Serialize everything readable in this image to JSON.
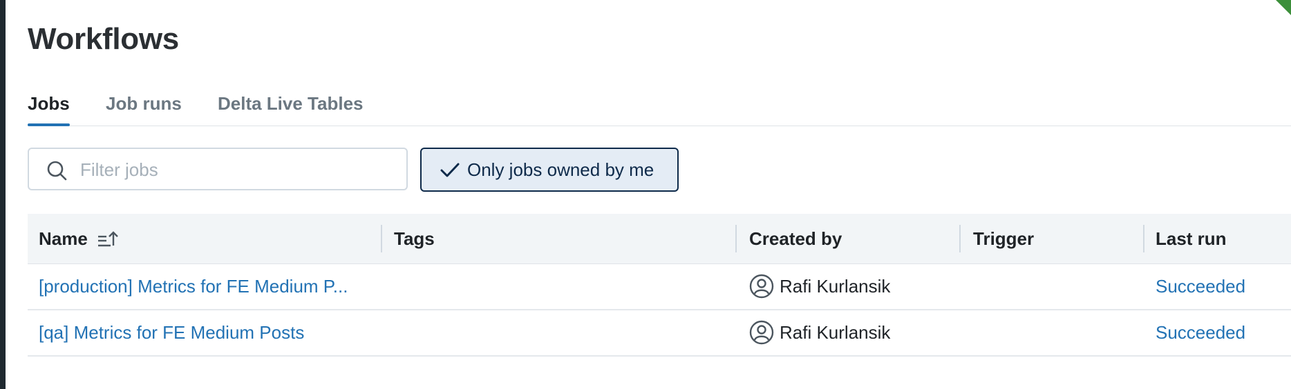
{
  "page": {
    "title": "Workflows"
  },
  "tabs": [
    {
      "label": "Jobs",
      "active": true
    },
    {
      "label": "Job runs",
      "active": false
    },
    {
      "label": "Delta Live Tables",
      "active": false
    }
  ],
  "search": {
    "placeholder": "Filter jobs",
    "value": "",
    "icon": "search-icon"
  },
  "filter_toggle": {
    "label": "Only jobs owned by me",
    "checked": true,
    "icon": "check-icon"
  },
  "table": {
    "columns": [
      "Name",
      "Tags",
      "Created by",
      "Trigger",
      "Last run"
    ],
    "rows": [
      {
        "name": "[production] Metrics for FE Medium P...",
        "tags": "",
        "created_by": "Rafi Kurlansik",
        "trigger": "",
        "last_run": "Succeeded"
      },
      {
        "name": "[qa] Metrics for FE Medium Posts",
        "tags": "",
        "created_by": "Rafi Kurlansik",
        "trigger": "",
        "last_run": "Succeeded"
      }
    ]
  },
  "colors": {
    "accent": "#2272b4",
    "toggle_bg": "#e4ecf5",
    "toggle_border": "#0e2a4a",
    "header_bg": "#f2f5f7"
  }
}
